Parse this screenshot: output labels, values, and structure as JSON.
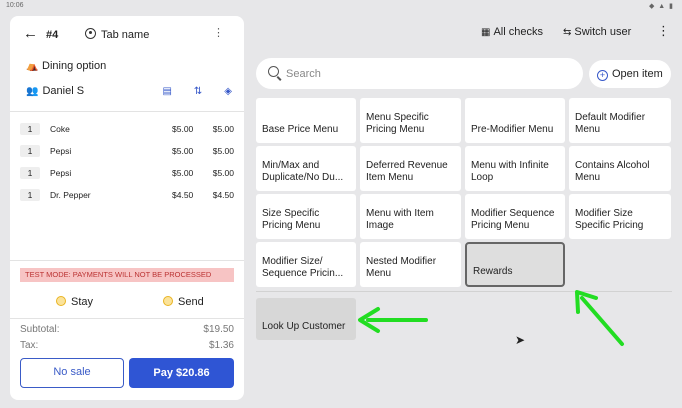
{
  "status_bar": {
    "time": "10:06",
    "icons": "◆ ▲ ▮"
  },
  "order": {
    "back_icon": "←",
    "check_number": "#4",
    "tab_name": "Tab name",
    "kebab": "⋮",
    "dining_option": "Dining option",
    "guest": "Daniel S",
    "items": [
      {
        "qty": "1",
        "name": "Coke",
        "price": "$5.00",
        "total": "$5.00"
      },
      {
        "qty": "1",
        "name": "Pepsi",
        "price": "$5.00",
        "total": "$5.00"
      },
      {
        "qty": "1",
        "name": "Pepsi",
        "price": "$5.00",
        "total": "$5.00"
      },
      {
        "qty": "1",
        "name": "Dr. Pepper",
        "price": "$4.50",
        "total": "$4.50"
      }
    ],
    "test_mode": "TEST MODE: PAYMENTS WILL NOT BE PROCESSED",
    "stay_label": "Stay",
    "send_label": "Send",
    "subtotal_label": "Subtotal:",
    "subtotal_value": "$19.50",
    "tax_label": "Tax:",
    "tax_value": "$1.36",
    "no_sale_label": "No sale",
    "pay_label": "Pay $20.86"
  },
  "toolbar": {
    "all_checks": "All checks",
    "switch_user": "Switch user",
    "kebab": "⋮"
  },
  "search": {
    "placeholder": "Search"
  },
  "open_item_label": "Open item",
  "menu_tiles": [
    "Base Price Menu",
    "Menu Specific Pricing Menu",
    "Pre-Modifier Menu",
    "Default Modifier Menu",
    "Min/Max and Duplicate/No Du...",
    "Deferred Revenue Item Menu",
    "Menu with Infinite Loop",
    "Contains Alcohol Menu",
    "Size Specific Pricing Menu",
    "Menu with Item Image",
    "Modifier Sequence Pricing Menu",
    "Modifier Size Specific Pricing",
    "Modifier Size/ Sequence Pricin...",
    "Nested Modifier Menu",
    "Rewards"
  ],
  "look_up_customer": "Look Up Customer",
  "annotation_color": "#22dd22",
  "accent_color": "#2f55d4"
}
